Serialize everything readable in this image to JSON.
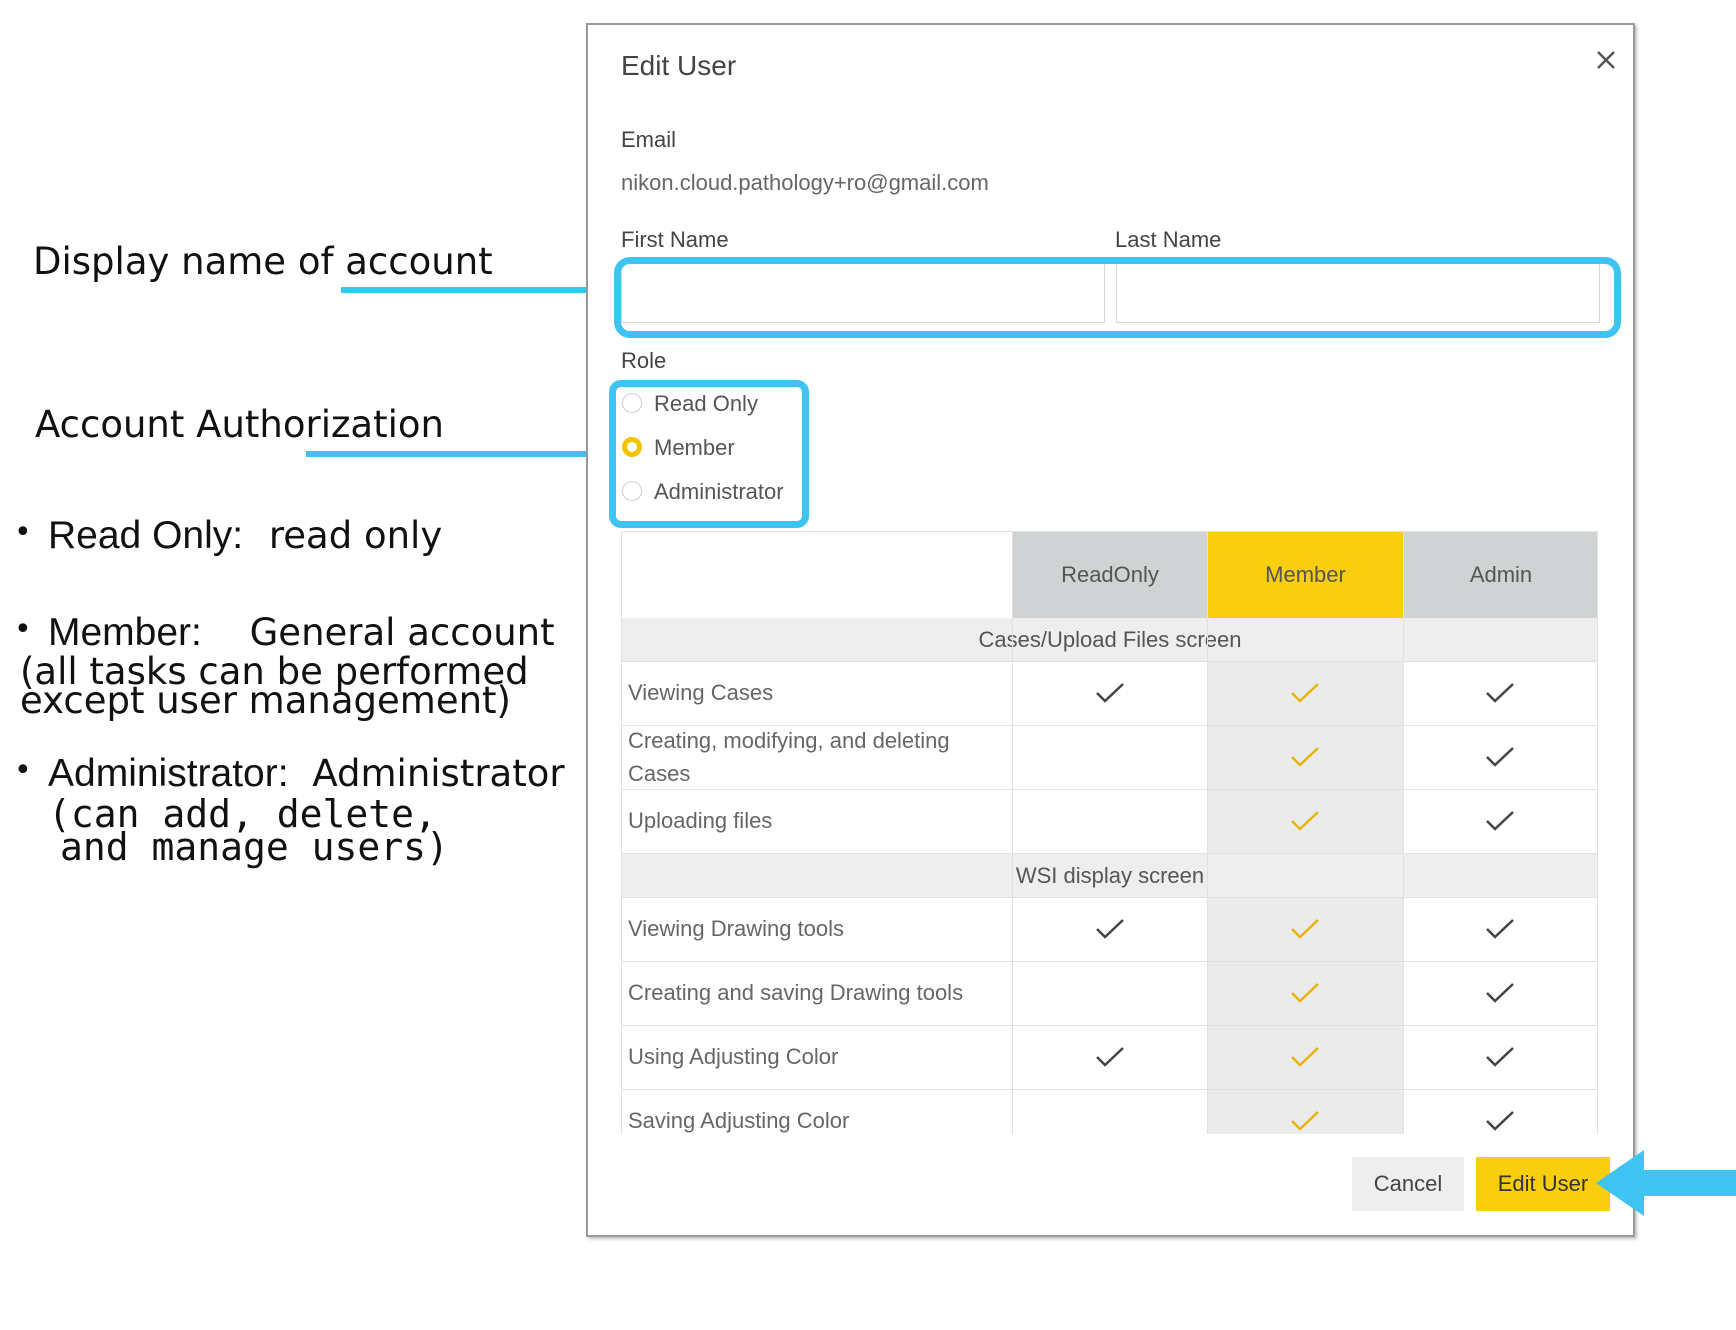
{
  "annotations": {
    "display_name": "Display name of account",
    "authorization": "Account Authorization",
    "read_only_term": "Read Only:",
    "read_only_desc": "read only",
    "member_term": "Member:",
    "member_desc": "General account",
    "member_note_1": "(all tasks can be performed",
    "member_note_2": "except user management)",
    "admin_term": "Administrator:",
    "admin_desc": "Administrator",
    "admin_note_1": "(can add, delete,",
    "admin_note_2": "and manage users)"
  },
  "dialog": {
    "title": "Edit User",
    "email_label": "Email",
    "email_value": "nikon.cloud.pathology+ro@gmail.com",
    "first_name_label": "First Name",
    "first_name_value": "",
    "last_name_label": "Last Name",
    "last_name_value": "",
    "role_label": "Role",
    "roles": [
      {
        "label": "Read Only",
        "selected": false
      },
      {
        "label": "Member",
        "selected": true
      },
      {
        "label": "Administrator",
        "selected": false
      }
    ],
    "cancel_label": "Cancel",
    "submit_label": "Edit User"
  },
  "permissions": {
    "columns": [
      "ReadOnly",
      "Member",
      "Admin"
    ],
    "sections": [
      {
        "title": "Cases/Upload Files screen",
        "rows": [
          {
            "label": "Viewing Cases",
            "checks": [
              true,
              true,
              true
            ]
          },
          {
            "label": "Creating, modifying, and deleting Cases",
            "checks": [
              false,
              true,
              true
            ]
          },
          {
            "label": "Uploading files",
            "checks": [
              false,
              true,
              true
            ]
          }
        ]
      },
      {
        "title": "WSI display screen",
        "rows": [
          {
            "label": "Viewing Drawing tools",
            "checks": [
              true,
              true,
              true
            ]
          },
          {
            "label": "Creating and saving Drawing tools",
            "checks": [
              false,
              true,
              true
            ]
          },
          {
            "label": "Using Adjusting Color",
            "checks": [
              true,
              true,
              true
            ]
          },
          {
            "label": "Saving Adjusting Color",
            "checks": [
              false,
              true,
              true
            ]
          }
        ]
      }
    ]
  },
  "colors": {
    "highlight": "#3ec3f2",
    "accent": "#f8ce0f",
    "header_gray": "#cfd3d4",
    "check_dark": "#444444",
    "check_accent": "#e8b30b"
  }
}
